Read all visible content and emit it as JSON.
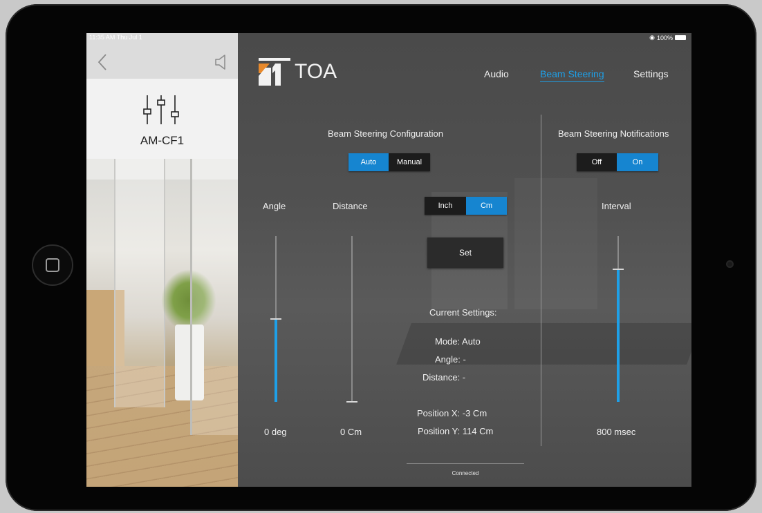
{
  "status": {
    "time": "11:35 AM  Thu Jul 1",
    "battery": "100%"
  },
  "device": {
    "name": "AM-CF1"
  },
  "brand": {
    "logo_text": "TOA"
  },
  "nav": {
    "tabs": [
      {
        "label": "Audio",
        "active": false
      },
      {
        "label": "Beam Steering",
        "active": true
      },
      {
        "label": "Settings",
        "active": false
      }
    ]
  },
  "config": {
    "title": "Beam Steering Configuration",
    "mode_options": [
      "Auto",
      "Manual"
    ],
    "mode_selected": "Auto"
  },
  "notifications": {
    "title": "Beam Steering Notifications",
    "options": [
      "Off",
      "On"
    ],
    "selected": "On",
    "interval_label": "Interval",
    "interval_value": "800 msec",
    "interval_level": 0.8
  },
  "angle": {
    "label": "Angle",
    "value": "0 deg",
    "level": 0.5
  },
  "distance": {
    "label": "Distance",
    "value": "0 Cm",
    "level": 0.0
  },
  "units": {
    "options": [
      "Inch",
      "Cm"
    ],
    "selected": "Cm"
  },
  "set_button": "Set",
  "current": {
    "title": "Current Settings:",
    "mode": "Mode: Auto",
    "angle": "Angle: -",
    "distance": "Distance: -",
    "pos_x": "Position X: -3 Cm",
    "pos_y": "Position Y: 114 Cm"
  },
  "connection": "Connected",
  "colors": {
    "accent": "#1ea0e8",
    "segment_on": "#1685d0",
    "segment_off": "#1c1c1c",
    "logo_orange": "#e8892b"
  }
}
